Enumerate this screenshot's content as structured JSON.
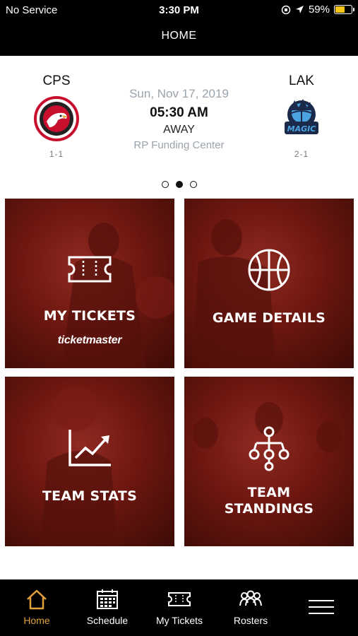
{
  "status_bar": {
    "carrier": "No Service",
    "time": "3:30 PM",
    "battery": "59%",
    "battery_level": 0.59
  },
  "header": {
    "title": "HOME"
  },
  "game": {
    "home_team": {
      "abbr": "CPS",
      "record": "1-1",
      "logo_icon": "college-park-skyhawks-logo"
    },
    "away_team": {
      "abbr": "LAK",
      "record": "2-1",
      "logo_icon": "lakeland-magic-logo"
    },
    "date": "Sun, Nov 17, 2019",
    "time": "05:30 AM",
    "location_type": "AWAY",
    "venue": "RP Funding Center"
  },
  "carousel": {
    "pages": 3,
    "active_page": 2
  },
  "tiles": [
    {
      "label": "MY TICKETS",
      "sub": "ticketmaster",
      "icon": "ticket-icon"
    },
    {
      "label": "GAME DETAILS",
      "icon": "basketball-icon"
    },
    {
      "label": "TEAM STATS",
      "icon": "chart-icon"
    },
    {
      "label_line1": "TEAM",
      "label_line2": "STANDINGS",
      "icon": "standings-tree-icon"
    }
  ],
  "nav": [
    {
      "label": "Home",
      "icon": "home-icon",
      "active": true
    },
    {
      "label": "Schedule",
      "icon": "calendar-icon"
    },
    {
      "label": "My Tickets",
      "icon": "ticket-icon"
    },
    {
      "label": "Rosters",
      "icon": "people-icon"
    },
    {
      "label": "",
      "icon": "menu-icon"
    }
  ],
  "colors": {
    "accent": "#e0a03c",
    "tile_red": "#6d1710",
    "muted_text": "#9aa3ad"
  }
}
